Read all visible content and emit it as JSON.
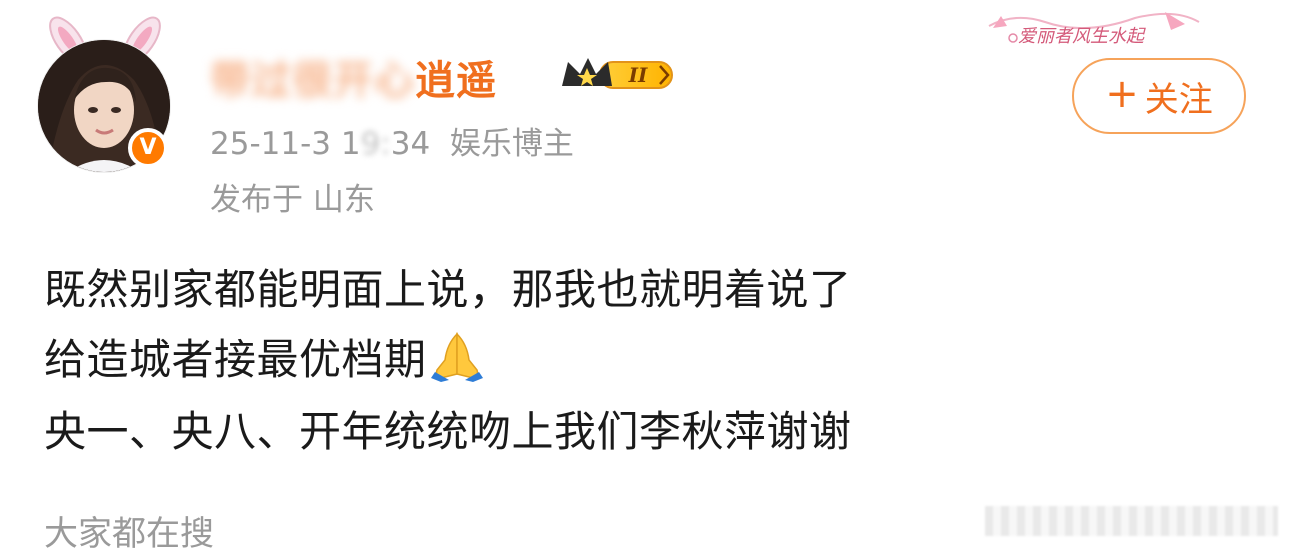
{
  "post": {
    "author": {
      "name_visible": "逍遥",
      "name_obscured": "带过很开心",
      "level_badge": "II",
      "verified_mark": "V"
    },
    "meta": {
      "date_prefix": "25-11-3 1",
      "time_obscured": "9:",
      "time_suffix": "34",
      "role": "娱乐博主",
      "location": "发布于 山东"
    },
    "follow_button": {
      "plus": "+",
      "label": "关注"
    },
    "content": {
      "line1": "既然别家都能明面上说，那我也就明着说了",
      "line2": "给造城者接最优档期",
      "line3": "央一、央八、开年统统吻上我们李秋萍谢谢"
    },
    "trending_label": "大家都在搜",
    "watermark": "爱丽者风生水起"
  },
  "colors": {
    "accent_orange": "#f06f1e",
    "follow_border": "#f6a35a",
    "meta_gray": "#9a9a9a",
    "verified_orange": "#ff7a00"
  },
  "icons": {
    "verified": "verified-badge-icon",
    "crown": "crown-level-icon",
    "pray": "folded-hands-emoji",
    "bunny": "bunny-ears-decoration"
  }
}
